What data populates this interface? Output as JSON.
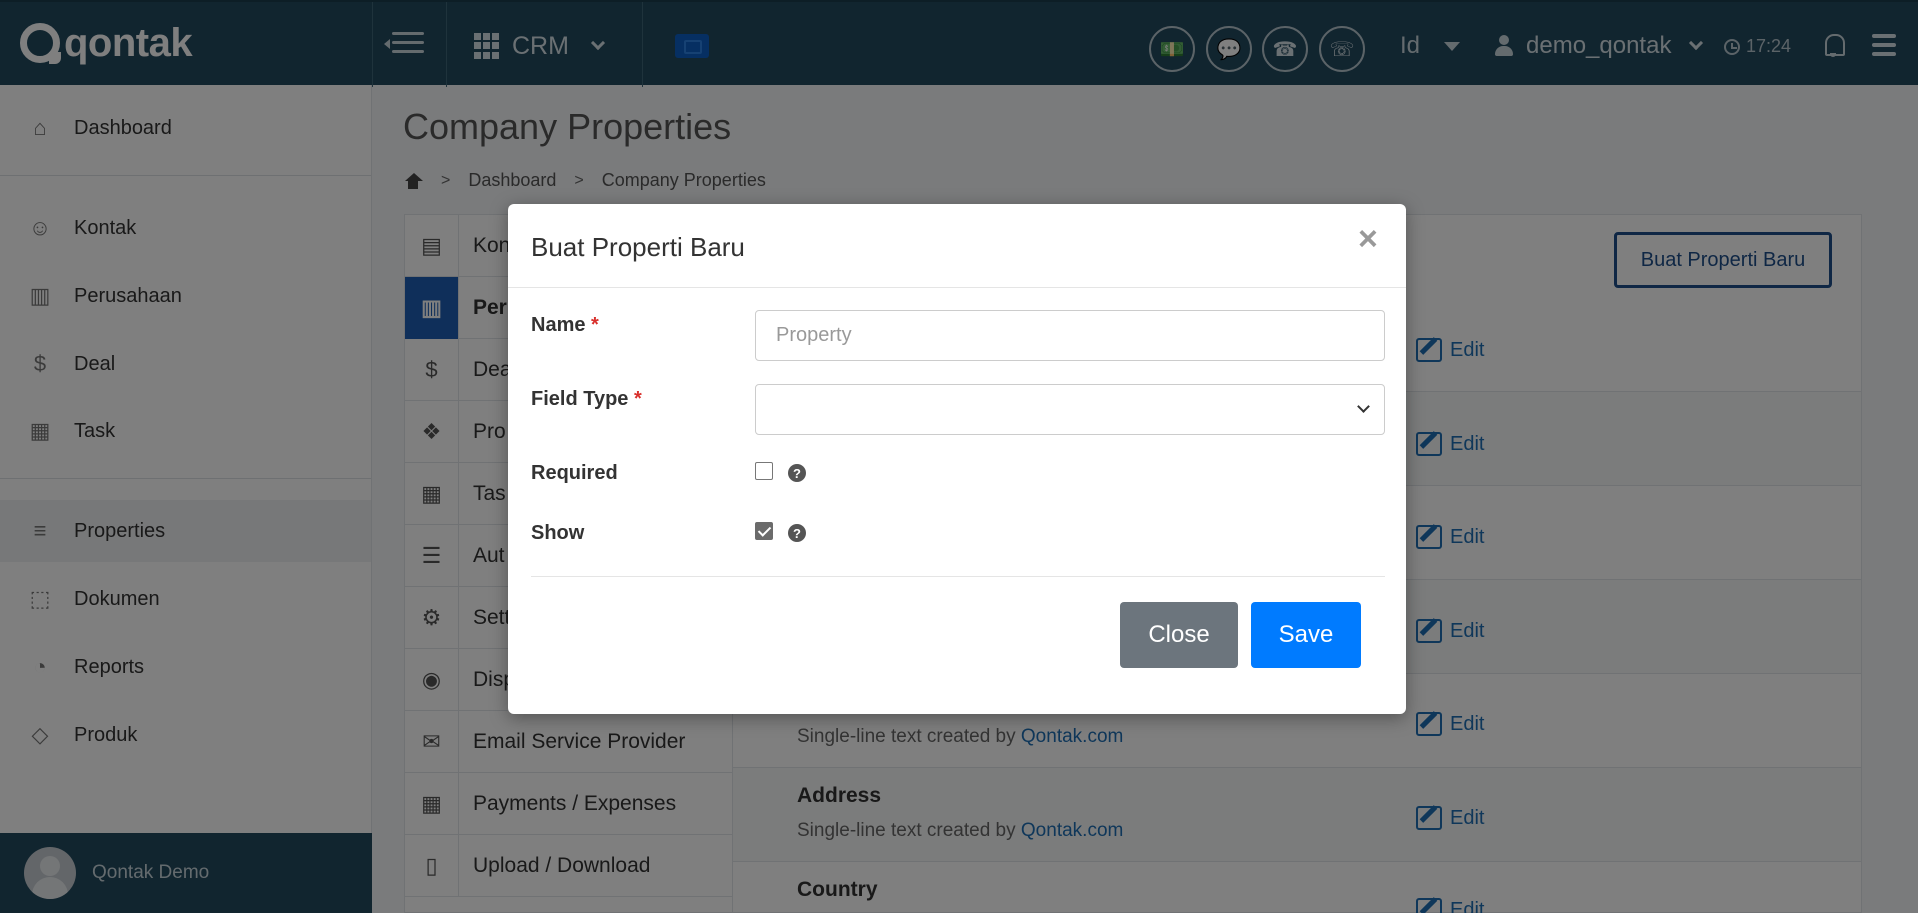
{
  "topbar": {
    "logo": "qontak",
    "module": "CRM",
    "lang": "Id",
    "username": "demo_qontak",
    "time": "17:24"
  },
  "sidebar": {
    "items": [
      {
        "label": "Dashboard",
        "icon": "home-icon"
      },
      {
        "label": "Kontak",
        "icon": "users-icon"
      },
      {
        "label": "Perusahaan",
        "icon": "building-icon"
      },
      {
        "label": "Deal",
        "icon": "dollar-icon"
      },
      {
        "label": "Task",
        "icon": "calendar-icon"
      },
      {
        "label": "Properties",
        "icon": "list-icon"
      },
      {
        "label": "Dokumen",
        "icon": "layers-icon"
      },
      {
        "label": "Reports",
        "icon": "pie-chart-icon"
      },
      {
        "label": "Produk",
        "icon": "tag-icon"
      }
    ],
    "user_name": "Qontak Demo"
  },
  "page": {
    "title": "Company Properties",
    "breadcrumb": [
      "Dashboard",
      "Company Properties"
    ],
    "new_button": "Buat Properti Baru"
  },
  "tabs": [
    {
      "label": "Kon",
      "icon": "id-card-icon"
    },
    {
      "label": "Per",
      "icon": "building-icon"
    },
    {
      "label": "Dea",
      "icon": "dollar-icon"
    },
    {
      "label": "Pro",
      "icon": "cubes-icon"
    },
    {
      "label": "Tas",
      "icon": "calendar-icon"
    },
    {
      "label": "Aut",
      "icon": "server-icon"
    },
    {
      "label": "Sett",
      "icon": "gear-icon"
    },
    {
      "label": "Disp",
      "icon": "eye-icon"
    },
    {
      "label": "Email Service Provider",
      "icon": "envelope-icon"
    },
    {
      "label": "Payments / Expenses",
      "icon": "calculator-icon"
    },
    {
      "label": "Upload / Download",
      "icon": "file-icon"
    }
  ],
  "properties": [
    {
      "name": "Address",
      "desc_prefix": "Single-line text created by ",
      "desc_link": "Qontak.com"
    },
    {
      "name": "Country",
      "desc_prefix": "",
      "desc_link": ""
    }
  ],
  "partial_desc": {
    "prefix": "Single-line text created by ",
    "link": "Qontak.com"
  },
  "edit_label": "Edit",
  "modal": {
    "title": "Buat Properti Baru",
    "close_symbol": "×",
    "name_label": "Name",
    "required_mark": "*",
    "name_placeholder": "Property",
    "field_type_label": "Field Type",
    "field_type_value": "",
    "required_label": "Required",
    "required_checked": false,
    "show_label": "Show",
    "show_checked": true,
    "help_symbol": "?",
    "close_button": "Close",
    "save_button": "Save"
  },
  "colors": {
    "topbar": "#234a5f",
    "primary": "#007bff",
    "secondary": "#6c757d",
    "link": "#1f6fb4"
  }
}
